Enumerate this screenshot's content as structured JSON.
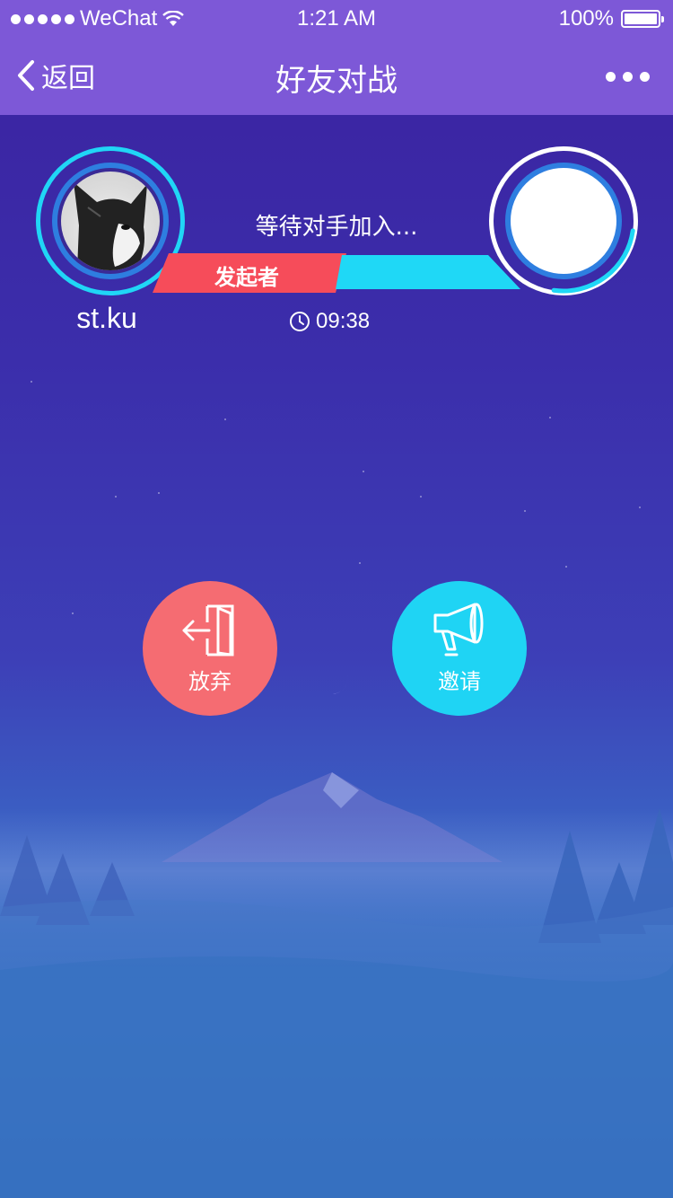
{
  "status_bar": {
    "carrier": "WeChat",
    "time": "1:21 AM",
    "battery": "100%"
  },
  "nav": {
    "back_label": "返回",
    "title": "好友对战"
  },
  "player_self": {
    "name": "st.ku",
    "role_badge": "发起者"
  },
  "match": {
    "status_text": "等待对手加入...",
    "timer": "09:38"
  },
  "actions": {
    "give_up_label": "放弃",
    "invite_label": "邀请"
  },
  "colors": {
    "header": "#7d58d7",
    "badge_red": "#f64c5a",
    "bar_cyan": "#1fd8f6",
    "giveup_btn": "#f56c72",
    "invite_btn": "#1fd4f4"
  }
}
